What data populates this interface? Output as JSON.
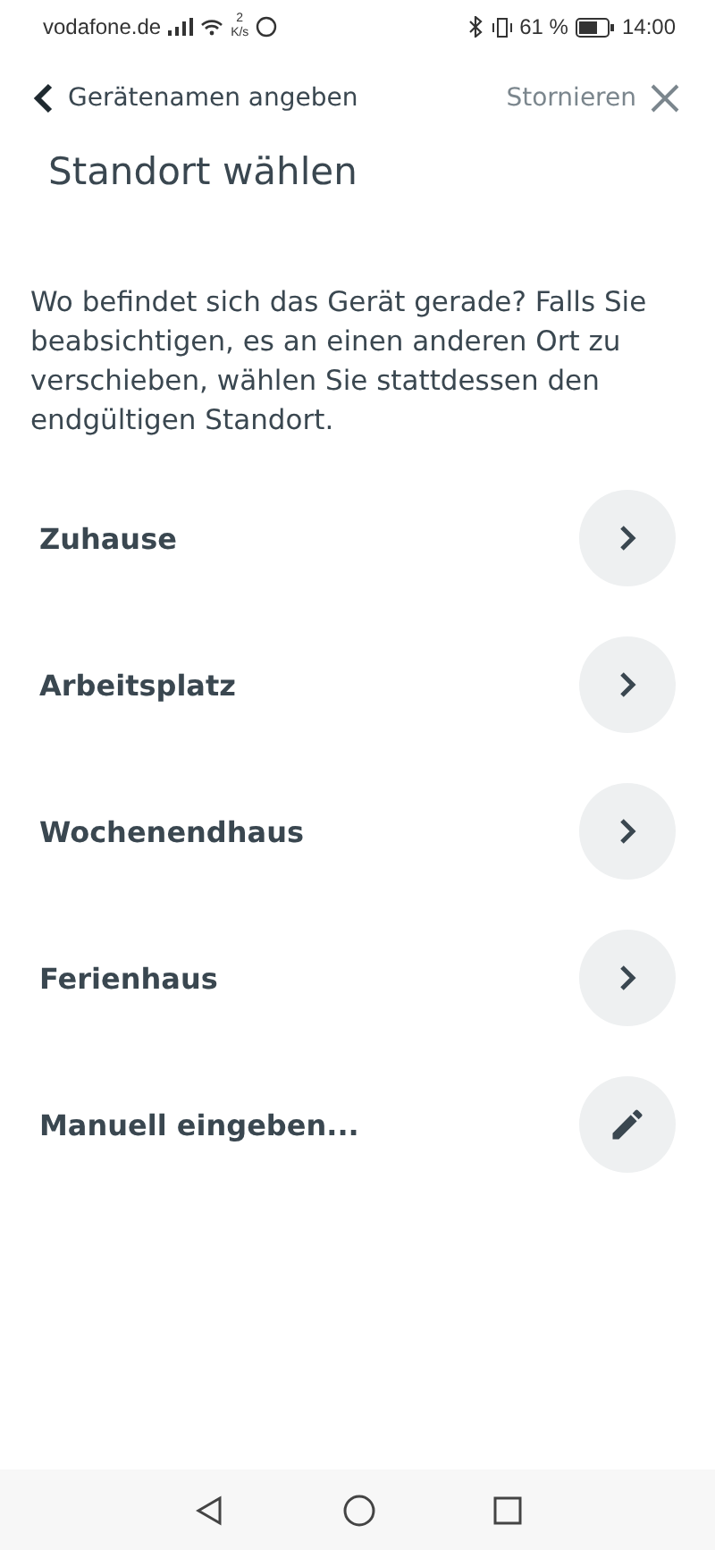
{
  "status_bar": {
    "carrier": "vodafone.de",
    "speed_value": "2",
    "speed_unit": "K/s",
    "battery": "61 %",
    "time": "14:00"
  },
  "header": {
    "back_label": "Gerätenamen angeben",
    "cancel_label": "Stornieren"
  },
  "title": "Standort wählen",
  "description": "Wo befindet sich das Gerät gerade? Falls Sie beabsichtigen, es an einen anderen Ort zu verschieben, wählen Sie stattdessen den endgültigen Standort.",
  "locations": [
    {
      "label": "Zuhause",
      "kind": "chevron"
    },
    {
      "label": "Arbeitsplatz",
      "kind": "chevron"
    },
    {
      "label": "Wochenendhaus",
      "kind": "chevron"
    },
    {
      "label": "Ferienhaus",
      "kind": "chevron"
    },
    {
      "label": "Manuell eingeben...",
      "kind": "edit"
    }
  ]
}
